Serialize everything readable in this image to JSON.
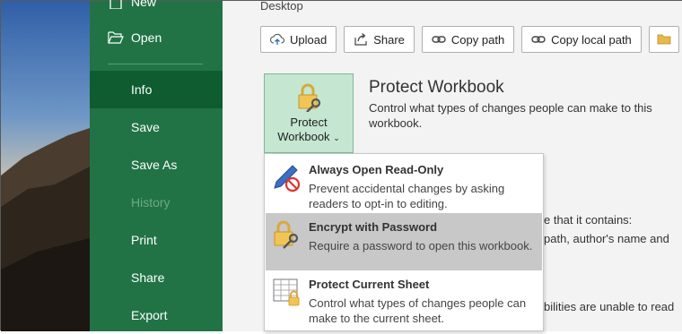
{
  "sidebar": {
    "items": [
      {
        "label": "New",
        "icon": "new-document-icon"
      },
      {
        "label": "Open",
        "icon": "folder-open-icon"
      },
      {
        "label": "Info",
        "active": true
      },
      {
        "label": "Save"
      },
      {
        "label": "Save As"
      },
      {
        "label": "History",
        "disabled": true
      },
      {
        "label": "Print"
      },
      {
        "label": "Share"
      },
      {
        "label": "Export"
      }
    ],
    "color": "#217346",
    "active_color": "#0e5c2f"
  },
  "main": {
    "breadcrumb": "Desktop",
    "toolbar": [
      {
        "label": "Upload",
        "icon": "upload-icon"
      },
      {
        "label": "Share",
        "icon": "share-icon"
      },
      {
        "label": "Copy path",
        "icon": "link-icon"
      },
      {
        "label": "Copy local path",
        "icon": "link-icon"
      },
      {
        "label": "",
        "icon": "folder-icon"
      }
    ],
    "protect": {
      "button_line1": "Protect",
      "button_line2": "Workbook",
      "title": "Protect Workbook",
      "description": "Control what types of changes people can make to this workbook."
    },
    "background_text": {
      "line1": "e that it contains:",
      "line2": "path, author's name and",
      "line3": "bilities are unable to read"
    }
  },
  "dropdown": {
    "items": [
      {
        "title": "Always Open Read-Only",
        "description": "Prevent accidental changes by asking readers to opt-in to editing.",
        "icon": "pencil-no-icon"
      },
      {
        "title": "Encrypt with Password",
        "description": "Require a password to open this workbook.",
        "icon": "lock-key-icon",
        "highlighted": true
      },
      {
        "title": "Protect Current Sheet",
        "description": "Control what types of changes people can make to the current sheet.",
        "icon": "sheet-lock-icon"
      }
    ]
  }
}
